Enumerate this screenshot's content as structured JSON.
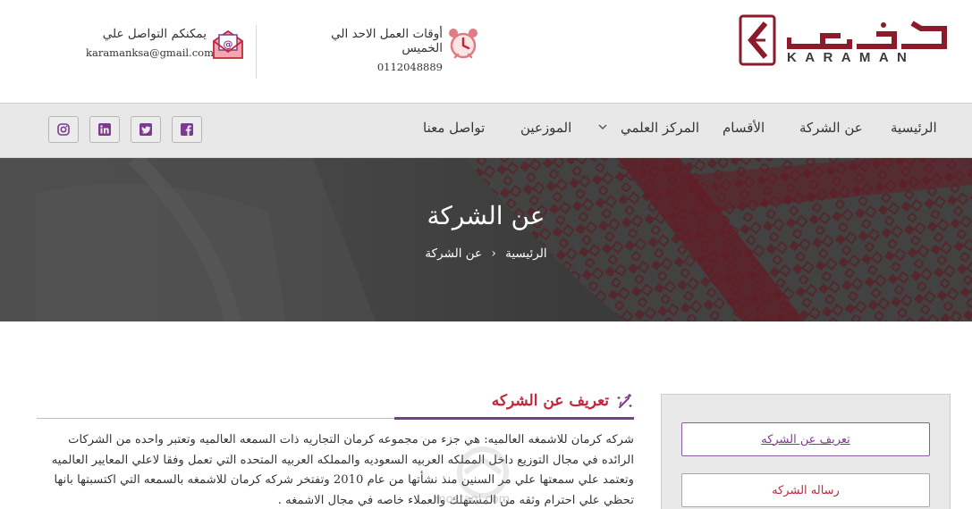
{
  "header": {
    "logo_en": "KARAMAN",
    "hours": {
      "title": "أوقات العمل الاحد الي الخميس",
      "phone": "0112048889"
    },
    "contact": {
      "title": "يمكنكم التواصل علي",
      "email": "karamanksa@gmail.com"
    }
  },
  "nav": {
    "home": "الرئيسية",
    "about": "عن الشركة",
    "sections": "الأقسام",
    "science": "المركز العلمي",
    "distributors": "الموزعين",
    "contact": "تواصل معنا"
  },
  "social": [
    "facebook-icon",
    "twitter-icon",
    "linkedin-icon",
    "instagram-icon"
  ],
  "hero": {
    "title": "عن الشركة",
    "breadcrumb_home": "الرئيسية",
    "breadcrumb_current": "عن الشركة"
  },
  "content": {
    "section_title": "تعريف عن الشركه",
    "body": "شركه كرمان للاشمغه العالميه: هي جزء من مجموعه كرمان التجاريه ذات السمعه العالميه وتعتبر واحده من الشركات الرائده في مجال التوزيع داخل المملكه العربيه السعوديه والمملكه العربيه المتحده التي تعمل وفقا لاعلي المعايير العالميه وتعتمد علي سمعتها علي مر السنين منذ نشأتها من عام 2010 وتفتخر شركه كرمان للاشمغه بالسمعه التي اكتسبتها بانها تحظي علي احترام وثقه من المستهلك والعملاء خاصه في مجال الاشمغه .",
    "watermark": "mostaql.com"
  },
  "sidebar": {
    "btn_about": "تعريف عن الشركه",
    "btn_message": "رساله الشركه"
  },
  "colors": {
    "brand_red": "#8b1a2b",
    "accent_purple": "#7b3b8f",
    "title_red": "#c0283d",
    "nav_bg": "#e8e8e8"
  }
}
